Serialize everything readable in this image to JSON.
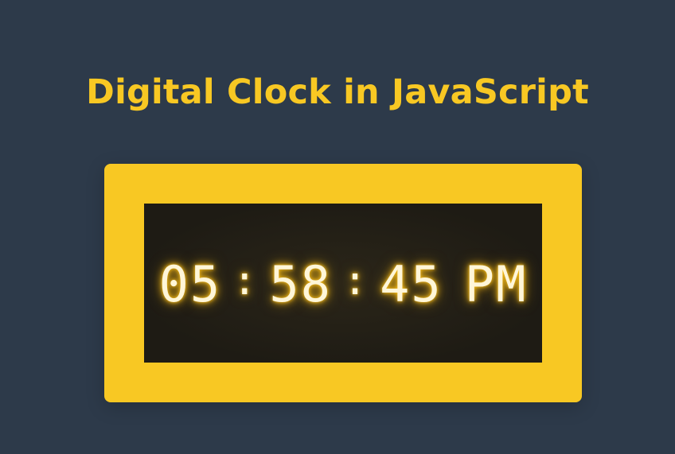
{
  "page": {
    "title": "Digital Clock in JavaScript"
  },
  "clock": {
    "hours": "05",
    "separator_1": ":",
    "minutes": "58",
    "separator_2": ":",
    "seconds": "45",
    "period": "PM"
  },
  "colors": {
    "background": "#2d3a4a",
    "accent": "#f8c823",
    "screen_background": "#1e1b14",
    "screen_glow": "#2b2619",
    "digit": "#fff6d8",
    "digit_glow": "#ffc21a"
  }
}
